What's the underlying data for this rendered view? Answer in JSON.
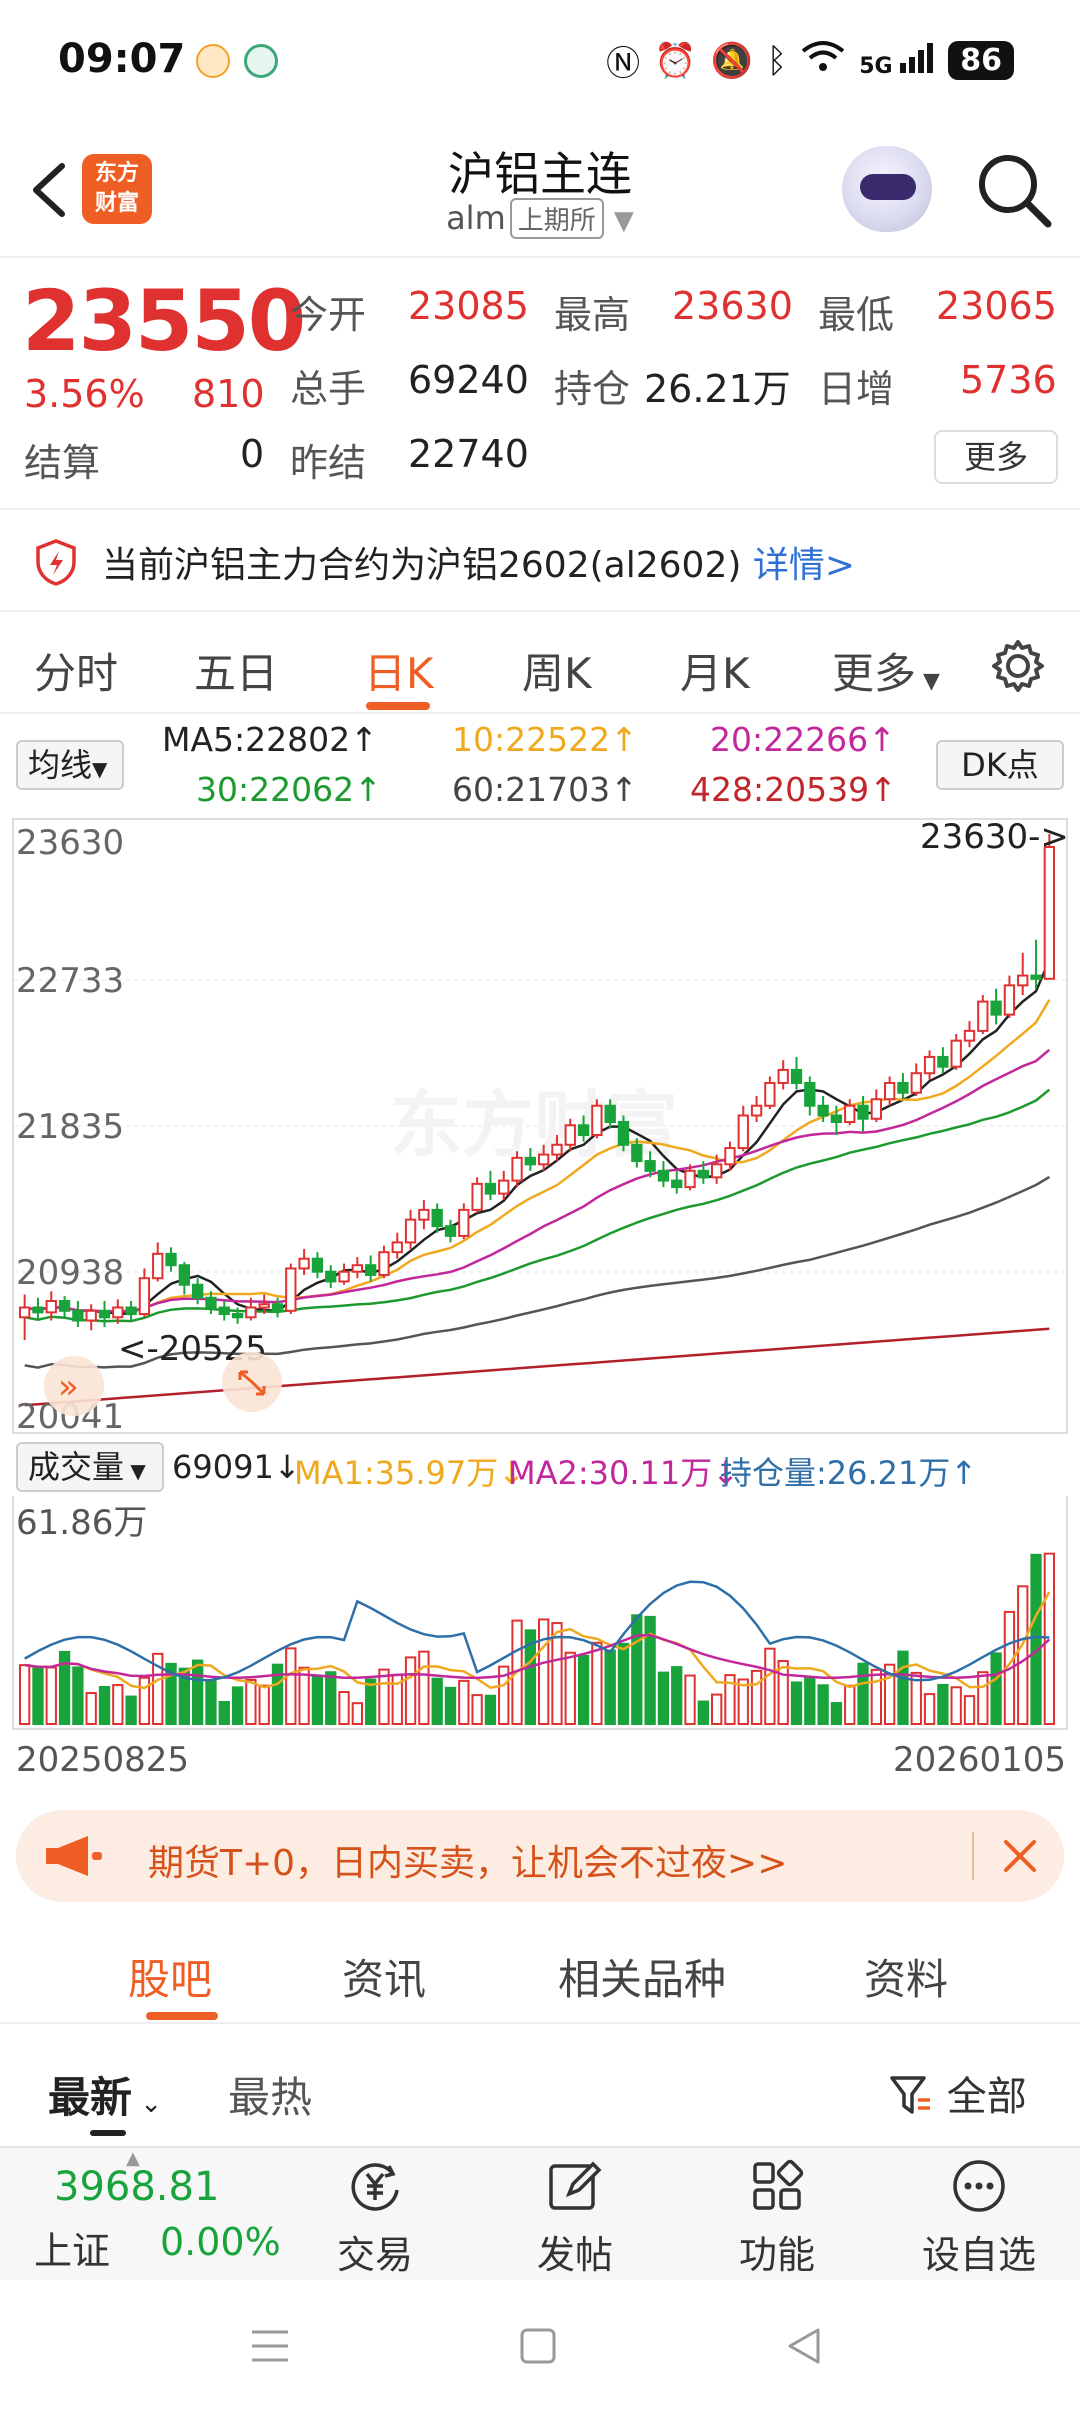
{
  "status_bar": {
    "time": "09:07",
    "network": "5G",
    "battery": "86"
  },
  "header": {
    "title": "沪铝主连",
    "symbol": "alm",
    "exchange": "上期所",
    "logo_text_1": "东方",
    "logo_text_2": "财富"
  },
  "quote": {
    "price": "23550",
    "change_pct": "3.56%",
    "change": "810",
    "open_label": "今开",
    "open": "23085",
    "high_label": "最高",
    "high": "23630",
    "low_label": "最低",
    "low": "23065",
    "volume_label": "总手",
    "volume": "69240",
    "open_interest_label": "持仓",
    "open_interest": "26.21万",
    "daily_increase_label": "日增",
    "daily_increase": "5736",
    "settle_label": "结算",
    "settle": "0",
    "prev_settle_label": "昨结",
    "prev_settle": "22740",
    "more_label": "更多"
  },
  "notice": {
    "text": "当前沪铝主力合约为沪铝2602(al2602)",
    "link": "详情>"
  },
  "chart_tabs": [
    "分时",
    "五日",
    "日K",
    "周K",
    "月K",
    "更多"
  ],
  "ma_row": {
    "selector": "均线",
    "ma5": "MA5:22802↑",
    "ma10": "10:22522↑",
    "ma20": "20:22266↑",
    "ma30": "30:22062↑",
    "ma60": "60:21703↑",
    "ma428": "428:20539↑",
    "dk_label": "DK点"
  },
  "kline": {
    "y_labels": [
      "23630",
      "22733",
      "21835",
      "20938",
      "20041"
    ],
    "high_marker": "23630->",
    "low_marker": "<-20525",
    "watermark": "东方财富"
  },
  "volume_row": {
    "selector": "成交量",
    "vol": "69091↓",
    "ma1": "MA1:35.97万↓",
    "ma2": "MA2:30.11万↓",
    "oi": "持仓量:26.21万↑",
    "max_label": "61.86万"
  },
  "dates": {
    "start": "20250825",
    "end": "20260105"
  },
  "promo": {
    "text": "期货T+0，日内买卖，让机会不过夜>>"
  },
  "sub_tabs": [
    "股吧",
    "资讯",
    "相关品种",
    "资料"
  ],
  "filter": {
    "latest": "最新",
    "hot": "最热",
    "all": "全部"
  },
  "bottom_nav": {
    "index_value": "3968.81",
    "index_name": "上证",
    "index_change": "0.00%",
    "items": [
      "交易",
      "发帖",
      "功能",
      "设自选"
    ]
  },
  "colors": {
    "accent": "#ef5e24",
    "up": "#e03131",
    "down": "#18a33b",
    "link": "#2f6fd6"
  },
  "chart_data": {
    "type": "candlestick",
    "x_range": [
      "20250825",
      "20260105"
    ],
    "ylim": [
      20041,
      23630
    ],
    "candles_approx": [
      [
        20660,
        20720,
        20520,
        20800
      ],
      [
        20720,
        20690,
        20650,
        20780
      ],
      [
        20690,
        20760,
        20640,
        20820
      ],
      [
        20760,
        20700,
        20660,
        20790
      ],
      [
        20700,
        20640,
        20600,
        20760
      ],
      [
        20640,
        20700,
        20580,
        20740
      ],
      [
        20700,
        20660,
        20600,
        20760
      ],
      [
        20660,
        20720,
        20620,
        20770
      ],
      [
        20720,
        20680,
        20640,
        20760
      ],
      [
        20680,
        20900,
        20660,
        20960
      ],
      [
        20900,
        21050,
        20880,
        21120
      ],
      [
        21050,
        20980,
        20940,
        21090
      ],
      [
        20980,
        20860,
        20800,
        21000
      ],
      [
        20860,
        20780,
        20740,
        20900
      ],
      [
        20780,
        20720,
        20680,
        20820
      ],
      [
        20720,
        20680,
        20640,
        20760
      ],
      [
        20680,
        20660,
        20620,
        20720
      ],
      [
        20660,
        20720,
        20640,
        20780
      ],
      [
        20720,
        20740,
        20680,
        20800
      ],
      [
        20740,
        20700,
        20660,
        20780
      ],
      [
        20700,
        20960,
        20680,
        20990
      ],
      [
        20960,
        21020,
        20920,
        21080
      ],
      [
        21020,
        20940,
        20900,
        21060
      ],
      [
        20940,
        20880,
        20840,
        20980
      ],
      [
        20880,
        20940,
        20860,
        20990
      ],
      [
        20940,
        20980,
        20900,
        21030
      ],
      [
        20980,
        20920,
        20880,
        21040
      ],
      [
        20920,
        21060,
        20900,
        21100
      ],
      [
        21060,
        21120,
        21020,
        21180
      ],
      [
        21120,
        21260,
        21080,
        21320
      ],
      [
        21260,
        21320,
        21200,
        21380
      ],
      [
        21320,
        21220,
        21180,
        21360
      ],
      [
        21220,
        21160,
        21120,
        21260
      ],
      [
        21160,
        21320,
        21140,
        21360
      ],
      [
        21320,
        21480,
        21300,
        21520
      ],
      [
        21480,
        21420,
        21380,
        21560
      ],
      [
        21420,
        21500,
        21380,
        21560
      ],
      [
        21500,
        21640,
        21460,
        21680
      ],
      [
        21640,
        21600,
        21560,
        21700
      ],
      [
        21600,
        21660,
        21560,
        21720
      ],
      [
        21660,
        21720,
        21620,
        21780
      ],
      [
        21720,
        21840,
        21680,
        21880
      ],
      [
        21840,
        21780,
        21740,
        21900
      ],
      [
        21780,
        21960,
        21760,
        22000
      ],
      [
        21960,
        21860,
        21820,
        22000
      ],
      [
        21860,
        21720,
        21680,
        21900
      ],
      [
        21720,
        21620,
        21580,
        21760
      ],
      [
        21620,
        21560,
        21520,
        21680
      ],
      [
        21560,
        21500,
        21460,
        21620
      ],
      [
        21500,
        21460,
        21420,
        21560
      ],
      [
        21460,
        21560,
        21440,
        21600
      ],
      [
        21560,
        21520,
        21480,
        21620
      ],
      [
        21520,
        21600,
        21480,
        21660
      ],
      [
        21600,
        21700,
        21560,
        21740
      ],
      [
        21700,
        21900,
        21680,
        21960
      ],
      [
        21900,
        21960,
        21860,
        22020
      ],
      [
        21960,
        22100,
        21940,
        22140
      ],
      [
        22100,
        22180,
        22060,
        22240
      ],
      [
        22180,
        22100,
        22060,
        22260
      ],
      [
        22100,
        21960,
        21900,
        22140
      ],
      [
        21960,
        21900,
        21860,
        22020
      ],
      [
        21900,
        21860,
        21780,
        21960
      ],
      [
        21860,
        21960,
        21840,
        22000
      ],
      [
        21960,
        21880,
        21800,
        22020
      ],
      [
        21880,
        22000,
        21860,
        22060
      ],
      [
        22000,
        22100,
        21960,
        22140
      ],
      [
        22100,
        22040,
        22000,
        22160
      ],
      [
        22040,
        22160,
        22020,
        22220
      ],
      [
        22160,
        22260,
        22120,
        22300
      ],
      [
        22260,
        22200,
        22160,
        22320
      ],
      [
        22200,
        22360,
        22180,
        22400
      ],
      [
        22360,
        22420,
        22320,
        22480
      ],
      [
        22420,
        22600,
        22400,
        22640
      ],
      [
        22600,
        22520,
        22460,
        22680
      ],
      [
        22520,
        22700,
        22500,
        22760
      ],
      [
        22700,
        22760,
        22640,
        22900
      ],
      [
        22760,
        22740,
        22680,
        22980
      ],
      [
        22740,
        23550,
        23065,
        23630
      ]
    ],
    "ma_lines": [
      "MA5",
      "MA10",
      "MA20",
      "MA30",
      "MA60",
      "MA428"
    ]
  }
}
